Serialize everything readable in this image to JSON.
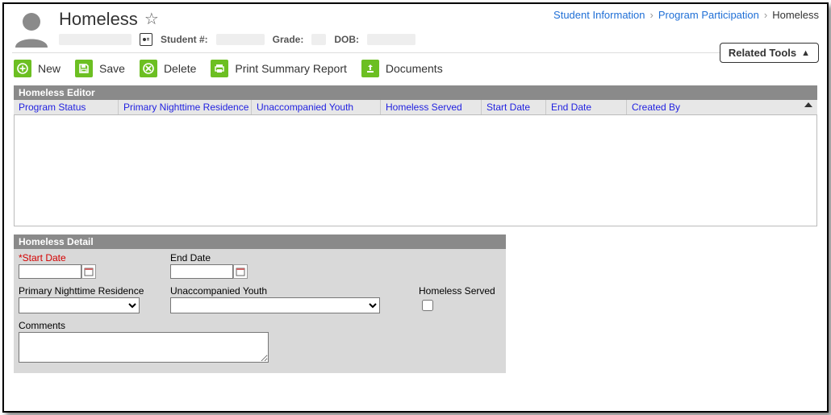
{
  "header": {
    "title": "Homeless",
    "student_num_label": "Student #:",
    "grade_label": "Grade:",
    "dob_label": "DOB:",
    "related_tools": "Related Tools"
  },
  "breadcrumb": {
    "a": "Student Information",
    "b": "Program Participation",
    "c": "Homeless"
  },
  "toolbar": {
    "new": "New",
    "save": "Save",
    "delete": "Delete",
    "print": "Print Summary Report",
    "documents": "Documents"
  },
  "editor": {
    "title": "Homeless Editor",
    "cols": {
      "program_status": "Program Status",
      "primary_residence": "Primary Nighttime Residence",
      "unaccompanied": "Unaccompanied Youth",
      "served": "Homeless Served",
      "start": "Start Date",
      "end": "End Date",
      "created_by": "Created By"
    }
  },
  "detail": {
    "title": "Homeless Detail",
    "labels": {
      "start": "*Start Date",
      "end": "End Date",
      "primary_residence": "Primary Nighttime Residence",
      "unaccompanied": "Unaccompanied Youth",
      "served": "Homeless Served",
      "comments": "Comments"
    },
    "values": {
      "start": "",
      "end": "",
      "primary_residence": "",
      "unaccompanied": "",
      "served_checked": false,
      "comments": ""
    }
  }
}
